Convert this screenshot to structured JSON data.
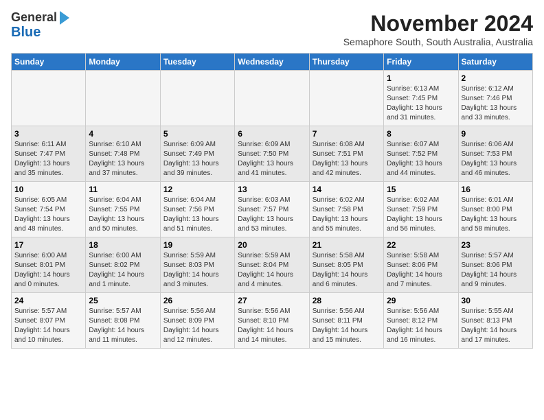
{
  "header": {
    "logo_line1": "General",
    "logo_line2": "Blue",
    "title": "November 2024",
    "subtitle": "Semaphore South, South Australia, Australia"
  },
  "weekdays": [
    "Sunday",
    "Monday",
    "Tuesday",
    "Wednesday",
    "Thursday",
    "Friday",
    "Saturday"
  ],
  "weeks": [
    [
      {
        "day": "",
        "info": ""
      },
      {
        "day": "",
        "info": ""
      },
      {
        "day": "",
        "info": ""
      },
      {
        "day": "",
        "info": ""
      },
      {
        "day": "",
        "info": ""
      },
      {
        "day": "1",
        "info": "Sunrise: 6:13 AM\nSunset: 7:45 PM\nDaylight: 13 hours\nand 31 minutes."
      },
      {
        "day": "2",
        "info": "Sunrise: 6:12 AM\nSunset: 7:46 PM\nDaylight: 13 hours\nand 33 minutes."
      }
    ],
    [
      {
        "day": "3",
        "info": "Sunrise: 6:11 AM\nSunset: 7:47 PM\nDaylight: 13 hours\nand 35 minutes."
      },
      {
        "day": "4",
        "info": "Sunrise: 6:10 AM\nSunset: 7:48 PM\nDaylight: 13 hours\nand 37 minutes."
      },
      {
        "day": "5",
        "info": "Sunrise: 6:09 AM\nSunset: 7:49 PM\nDaylight: 13 hours\nand 39 minutes."
      },
      {
        "day": "6",
        "info": "Sunrise: 6:09 AM\nSunset: 7:50 PM\nDaylight: 13 hours\nand 41 minutes."
      },
      {
        "day": "7",
        "info": "Sunrise: 6:08 AM\nSunset: 7:51 PM\nDaylight: 13 hours\nand 42 minutes."
      },
      {
        "day": "8",
        "info": "Sunrise: 6:07 AM\nSunset: 7:52 PM\nDaylight: 13 hours\nand 44 minutes."
      },
      {
        "day": "9",
        "info": "Sunrise: 6:06 AM\nSunset: 7:53 PM\nDaylight: 13 hours\nand 46 minutes."
      }
    ],
    [
      {
        "day": "10",
        "info": "Sunrise: 6:05 AM\nSunset: 7:54 PM\nDaylight: 13 hours\nand 48 minutes."
      },
      {
        "day": "11",
        "info": "Sunrise: 6:04 AM\nSunset: 7:55 PM\nDaylight: 13 hours\nand 50 minutes."
      },
      {
        "day": "12",
        "info": "Sunrise: 6:04 AM\nSunset: 7:56 PM\nDaylight: 13 hours\nand 51 minutes."
      },
      {
        "day": "13",
        "info": "Sunrise: 6:03 AM\nSunset: 7:57 PM\nDaylight: 13 hours\nand 53 minutes."
      },
      {
        "day": "14",
        "info": "Sunrise: 6:02 AM\nSunset: 7:58 PM\nDaylight: 13 hours\nand 55 minutes."
      },
      {
        "day": "15",
        "info": "Sunrise: 6:02 AM\nSunset: 7:59 PM\nDaylight: 13 hours\nand 56 minutes."
      },
      {
        "day": "16",
        "info": "Sunrise: 6:01 AM\nSunset: 8:00 PM\nDaylight: 13 hours\nand 58 minutes."
      }
    ],
    [
      {
        "day": "17",
        "info": "Sunrise: 6:00 AM\nSunset: 8:01 PM\nDaylight: 14 hours\nand 0 minutes."
      },
      {
        "day": "18",
        "info": "Sunrise: 6:00 AM\nSunset: 8:02 PM\nDaylight: 14 hours\nand 1 minute."
      },
      {
        "day": "19",
        "info": "Sunrise: 5:59 AM\nSunset: 8:03 PM\nDaylight: 14 hours\nand 3 minutes."
      },
      {
        "day": "20",
        "info": "Sunrise: 5:59 AM\nSunset: 8:04 PM\nDaylight: 14 hours\nand 4 minutes."
      },
      {
        "day": "21",
        "info": "Sunrise: 5:58 AM\nSunset: 8:05 PM\nDaylight: 14 hours\nand 6 minutes."
      },
      {
        "day": "22",
        "info": "Sunrise: 5:58 AM\nSunset: 8:06 PM\nDaylight: 14 hours\nand 7 minutes."
      },
      {
        "day": "23",
        "info": "Sunrise: 5:57 AM\nSunset: 8:06 PM\nDaylight: 14 hours\nand 9 minutes."
      }
    ],
    [
      {
        "day": "24",
        "info": "Sunrise: 5:57 AM\nSunset: 8:07 PM\nDaylight: 14 hours\nand 10 minutes."
      },
      {
        "day": "25",
        "info": "Sunrise: 5:57 AM\nSunset: 8:08 PM\nDaylight: 14 hours\nand 11 minutes."
      },
      {
        "day": "26",
        "info": "Sunrise: 5:56 AM\nSunset: 8:09 PM\nDaylight: 14 hours\nand 12 minutes."
      },
      {
        "day": "27",
        "info": "Sunrise: 5:56 AM\nSunset: 8:10 PM\nDaylight: 14 hours\nand 14 minutes."
      },
      {
        "day": "28",
        "info": "Sunrise: 5:56 AM\nSunset: 8:11 PM\nDaylight: 14 hours\nand 15 minutes."
      },
      {
        "day": "29",
        "info": "Sunrise: 5:56 AM\nSunset: 8:12 PM\nDaylight: 14 hours\nand 16 minutes."
      },
      {
        "day": "30",
        "info": "Sunrise: 5:55 AM\nSunset: 8:13 PM\nDaylight: 14 hours\nand 17 minutes."
      }
    ]
  ]
}
